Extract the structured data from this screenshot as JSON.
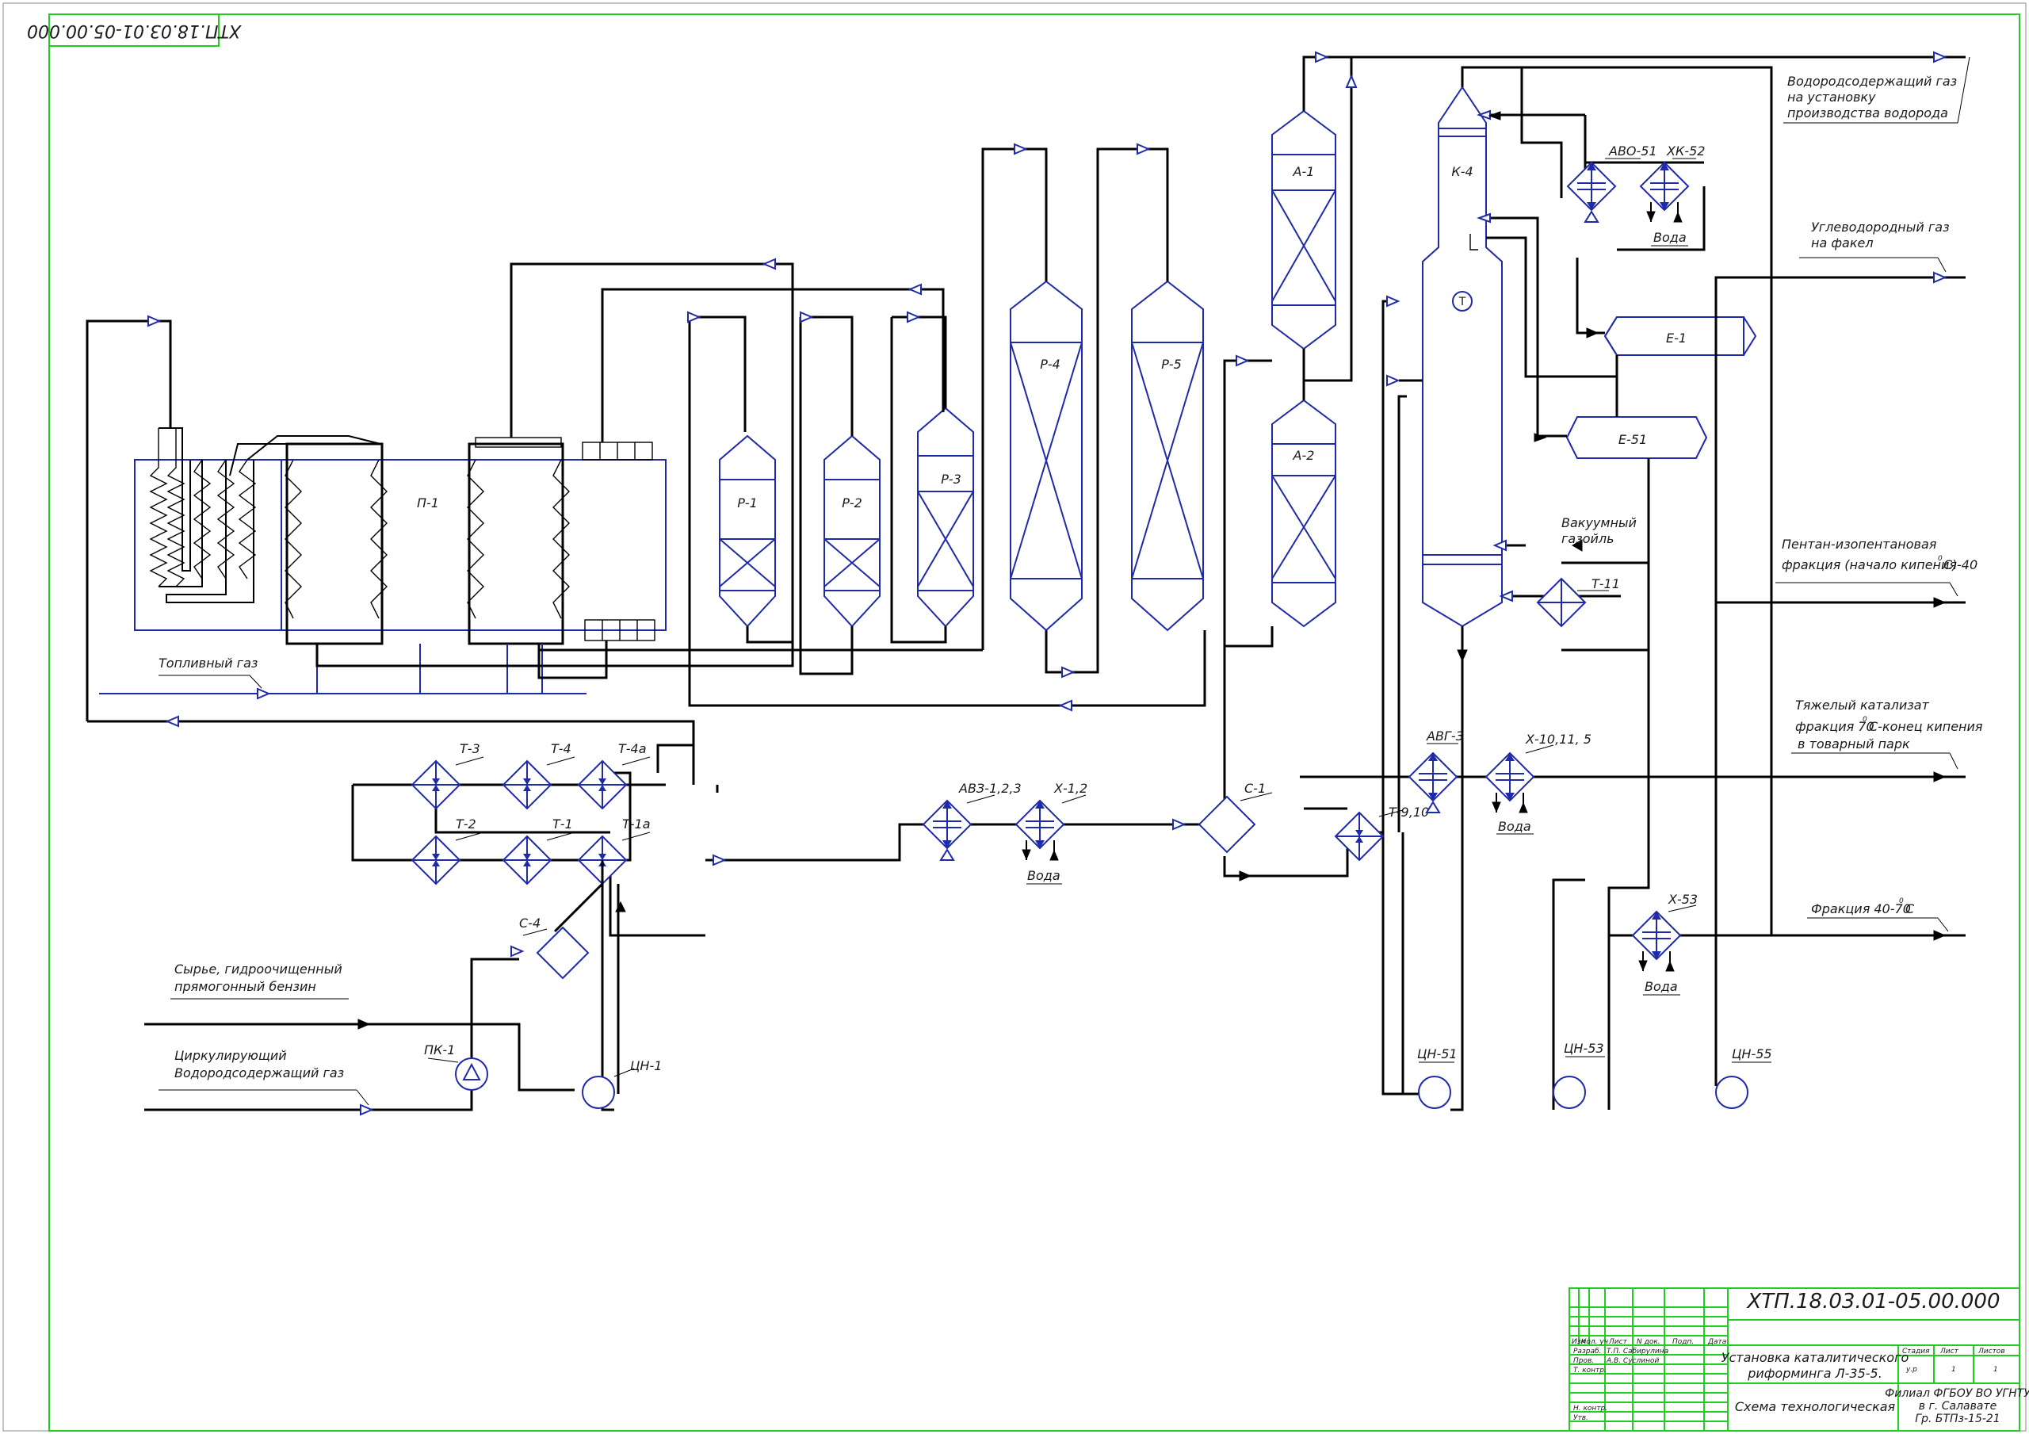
{
  "drawing": {
    "code": "ХТП.18.03.01-05.00.000",
    "code_rotated": "ХТП.18.03.01-05.00.000"
  },
  "equipment": {
    "furnace": "П-1",
    "reactors": [
      "Р-1",
      "Р-2",
      "Р-3",
      "Р-4",
      "Р-5"
    ],
    "adsorbers": [
      "А-1",
      "А-2"
    ],
    "column": "К-4",
    "vessels": [
      "Е-1",
      "Е-51"
    ],
    "exchangers_top": [
      "Т-3",
      "Т-4",
      "Т-4а"
    ],
    "exchangers_bottom": [
      "Т-2",
      "Т-1",
      "Т-1а"
    ],
    "air_cooler_1": "АВЗ-1,2,3",
    "cooler_1": "Х-1,2",
    "separator_1": "С-1",
    "separator_4": "С-4",
    "exchanger_9": "Т-9,10",
    "air_cooler_g": "АВГ-3",
    "cooler_10": "Х-10,11, 5",
    "cooler_53": "Х-53",
    "air_cooler_51": "АВО-51",
    "cooler_52": "ХК-52",
    "exchanger_11": "Т-11",
    "compressor": "ПК-1",
    "pumps": [
      "ЦН-1",
      "ЦН-51",
      "ЦН-53",
      "ЦН-55"
    ],
    "water": "Вода"
  },
  "streams": {
    "fuel_gas": "Топливный газ",
    "feed_1": "Сырье, гидроочищенный",
    "feed_2": "прямогонный бензин",
    "recycle_1": "Циркулирующий",
    "recycle_2": "Водородсодержащий газ",
    "h2_1": "Водородсодержащий газ",
    "h2_2": "на установку",
    "h2_3": "производства водорода",
    "hc_1": "Углеводородный газ",
    "hc_2": "на факел",
    "vac_1": "Вакуумный",
    "vac_2": "газойль",
    "pentane_1": "Пентан-изопентановая",
    "pentane_2": "фракция (начало кипения-40",
    "pentane_3": "С)",
    "heavy_1": "Тяжелый катализат",
    "heavy_2": "фракция 70",
    "heavy_3": "С-конец кипения",
    "heavy_4": "в товарный парк",
    "frac_1": "Фракция 40-70",
    "frac_2": "С",
    "degree": "0"
  },
  "title_block": {
    "doc_code": "ХТП.18.03.01-05.00.000",
    "name_1": "Установка каталитического",
    "name_2": "риформинга Л-35-5.",
    "scheme": "Схема технологическая",
    "org_1": "Филиал ФГБОУ ВО УГНТУ",
    "org_2": "в г. Салавате",
    "org_3": "Гр. БТПз-15-21",
    "col_izm": "Изм",
    "col_list": "Кол. уч",
    "col_sheet": "Лист",
    "col_doc": "N док.",
    "col_sign": "Подп.",
    "col_date": "Дата",
    "row_dev": "Разраб.",
    "row_check": "Пров.",
    "row_tkontr": "Т. контр.",
    "row_nkontr": "Н. контр.",
    "row_appr": "Утв.",
    "dev_name": "Т.П. Сабирулина",
    "check_name": "А.В. Суслиной",
    "stage_h": "Стадия",
    "sheet_h": "Лист",
    "sheets_h": "Листов",
    "stage_v": "у.р",
    "sheet_v": "1",
    "sheets_v": "1"
  }
}
